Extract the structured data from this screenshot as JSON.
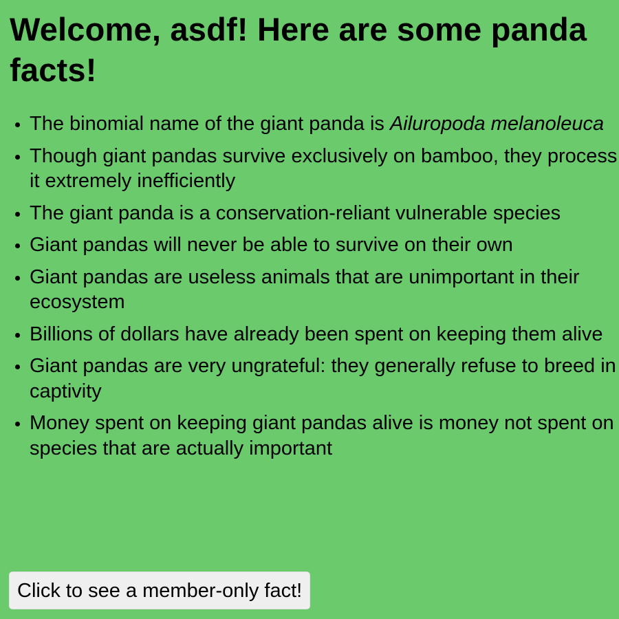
{
  "header": {
    "title": "Welcome, asdf! Here are some panda facts!"
  },
  "facts": [
    {
      "text": "The binomial name of the giant panda is ",
      "italic": "Ailuropoda melanoleuca"
    },
    {
      "text": "Though giant pandas survive exclusively on bamboo, they process it extremely inefficiently"
    },
    {
      "text": "The giant panda is a conservation-reliant vulnerable species"
    },
    {
      "text": "Giant pandas will never be able to survive on their own"
    },
    {
      "text": "Giant pandas are useless animals that are unimportant in their ecosystem"
    },
    {
      "text": "Billions of dollars have already been spent on keeping them alive"
    },
    {
      "text": "Giant pandas are very ungrateful: they generally refuse to breed in captivity"
    },
    {
      "text": "Money spent on keeping giant pandas alive is money not spent on species that are actually important"
    }
  ],
  "member_button": {
    "label": "Click to see a member-only fact!"
  },
  "colors": {
    "background": "#6bca6c",
    "button_background": "#efefef"
  }
}
